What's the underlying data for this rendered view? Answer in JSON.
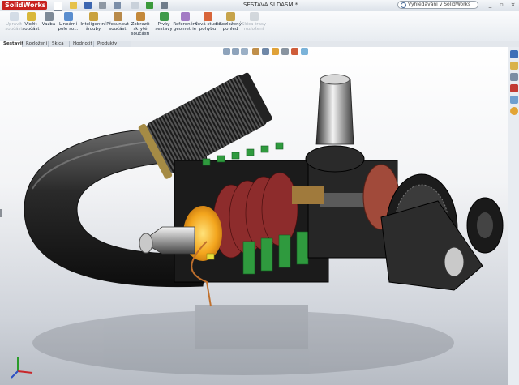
{
  "app": {
    "logo_text": "SolidWorks",
    "document_title": "SESTAVA.SLDASM *",
    "search_placeholder": "Vyhledávání v SolidWorks",
    "colors": {
      "brand": "#c7221f",
      "ribbon_bg": "#eef1f5",
      "viewport_top": "#ffffff",
      "viewport_bottom": "#b7bcc4"
    }
  },
  "quick_access": [
    "new-icon",
    "open-icon",
    "save-icon",
    "print-icon",
    "undo-icon",
    "select-icon",
    "rebuild-icon",
    "options-icon"
  ],
  "ribbon": {
    "buttons": [
      {
        "label": "Upravit součást",
        "icon": "edit-part-icon",
        "enabled": false
      },
      {
        "label": "Vložit součást",
        "icon": "insert-component-icon",
        "enabled": true
      },
      {
        "label": "Vazba",
        "icon": "mate-icon",
        "enabled": true
      },
      {
        "label": "Lineární pole so...",
        "icon": "linear-pattern-icon",
        "enabled": true
      },
      {
        "label": "Inteligentní šrouby",
        "icon": "smart-fasteners-icon",
        "enabled": true
      },
      {
        "label": "Přesunout součást",
        "icon": "move-component-icon",
        "enabled": true
      },
      {
        "label": "Zobrazit skryté součásti",
        "icon": "show-hidden-icon",
        "enabled": true
      },
      {
        "label": "Prvky sestavy",
        "icon": "assembly-features-icon",
        "enabled": true
      },
      {
        "label": "Referenční geometrie",
        "icon": "reference-geometry-icon",
        "enabled": true
      },
      {
        "label": "Nová studie pohybu",
        "icon": "motion-study-icon",
        "enabled": true
      },
      {
        "label": "Rozložený pohled",
        "icon": "exploded-view-icon",
        "enabled": true
      },
      {
        "label": "Skica trasy rozložení",
        "icon": "explode-line-sketch-icon",
        "enabled": false
      }
    ]
  },
  "tabs": [
    {
      "label": "Sestavit",
      "active": true
    },
    {
      "label": "Rozložení",
      "active": false
    },
    {
      "label": "Skica",
      "active": false
    },
    {
      "label": "Hodnotit",
      "active": false
    },
    {
      "label": "Produkty Office",
      "active": false
    }
  ],
  "heads_up_toolbar": [
    "zoom-to-fit-icon",
    "zoom-area-icon",
    "previous-view-icon",
    "section-view-icon",
    "view-orientation-icon",
    "display-style-icon",
    "hide-show-icon",
    "edit-appearance-icon",
    "scene-icon"
  ],
  "task_pane": [
    "resources-icon",
    "design-library-icon",
    "file-explorer-icon",
    "search-results-icon",
    "view-palette-icon",
    "appearances-icon"
  ],
  "model": {
    "description_icon": "supercharger-assembly-icon"
  }
}
